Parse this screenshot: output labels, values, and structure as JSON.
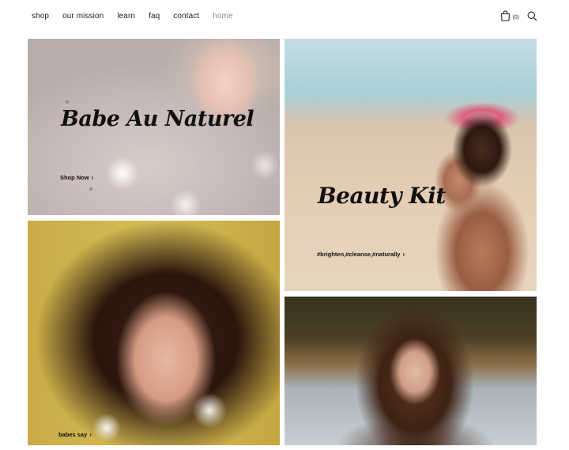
{
  "nav": {
    "links": [
      "shop",
      "our mission",
      "learn",
      "faq",
      "contact",
      "home"
    ],
    "cart_count": "(0)"
  },
  "tiles": {
    "t1": {
      "title": "Babe Au Naturel",
      "link": "Shop Now"
    },
    "t2": {
      "title": "Beauty Kit",
      "link": "#brighten,#cleanse,#naturally"
    },
    "t3": {
      "link": "babes say"
    }
  },
  "icons": {
    "cart": "shopping-bag-icon",
    "search": "search-icon",
    "chevron": "chevron-right-icon"
  },
  "colors": {
    "text": "#111111",
    "muted_link": "#8a8a8a",
    "background": "#ffffff"
  }
}
